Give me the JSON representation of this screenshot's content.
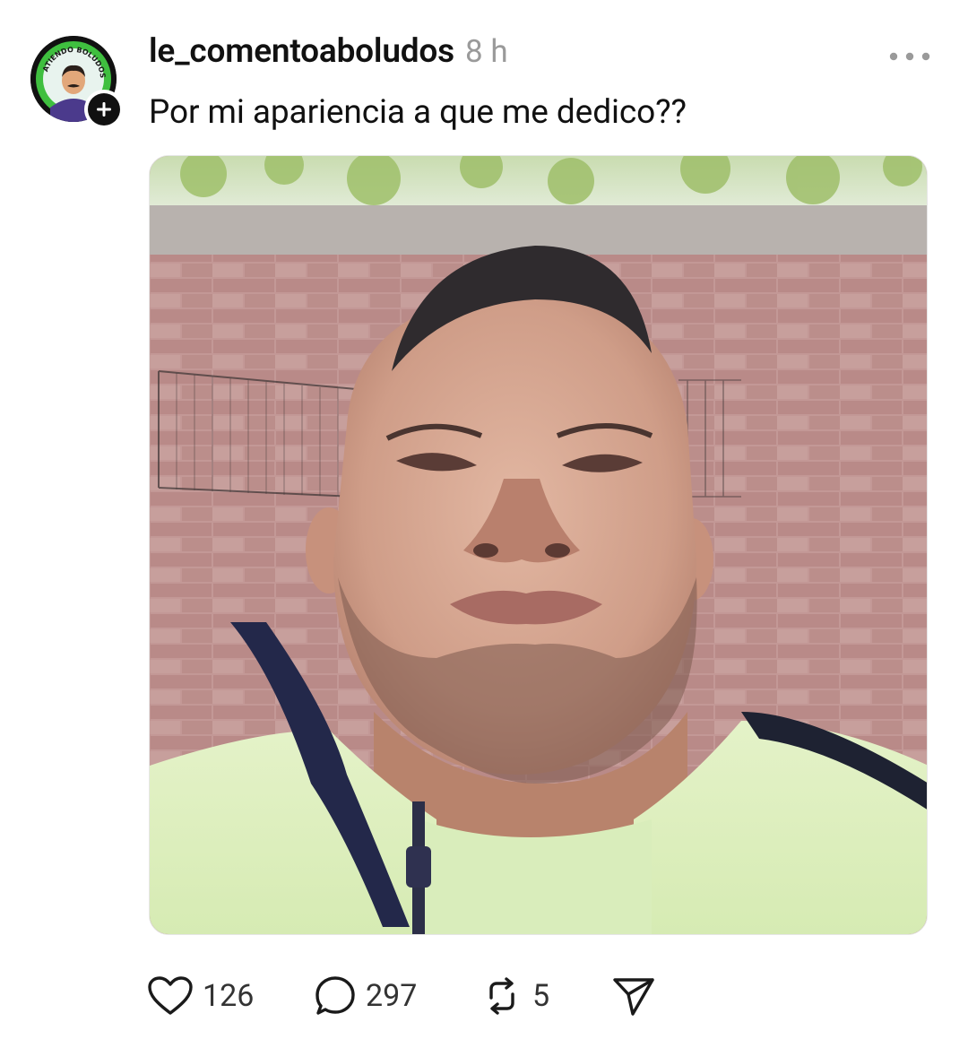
{
  "post": {
    "username": "le_comentoaboludos",
    "timestamp": "8 h",
    "caption": "Por mi apariencia a que me dedico??",
    "avatar": {
      "badge_text": "ATIENDO BOLUDOS"
    },
    "photo": {
      "description_icon": "selfie-photo"
    },
    "actions": {
      "likes": "126",
      "replies": "297",
      "reposts": "5"
    }
  },
  "colors": {
    "text_primary": "#111111",
    "text_secondary": "#9a9a9a",
    "avatar_ring": "#3fbf3f"
  },
  "icons": {
    "more": "more-horizontal-icon",
    "like": "heart-icon",
    "reply": "comment-bubble-icon",
    "repost": "repost-icon",
    "share": "send-icon",
    "follow": "plus-icon"
  }
}
